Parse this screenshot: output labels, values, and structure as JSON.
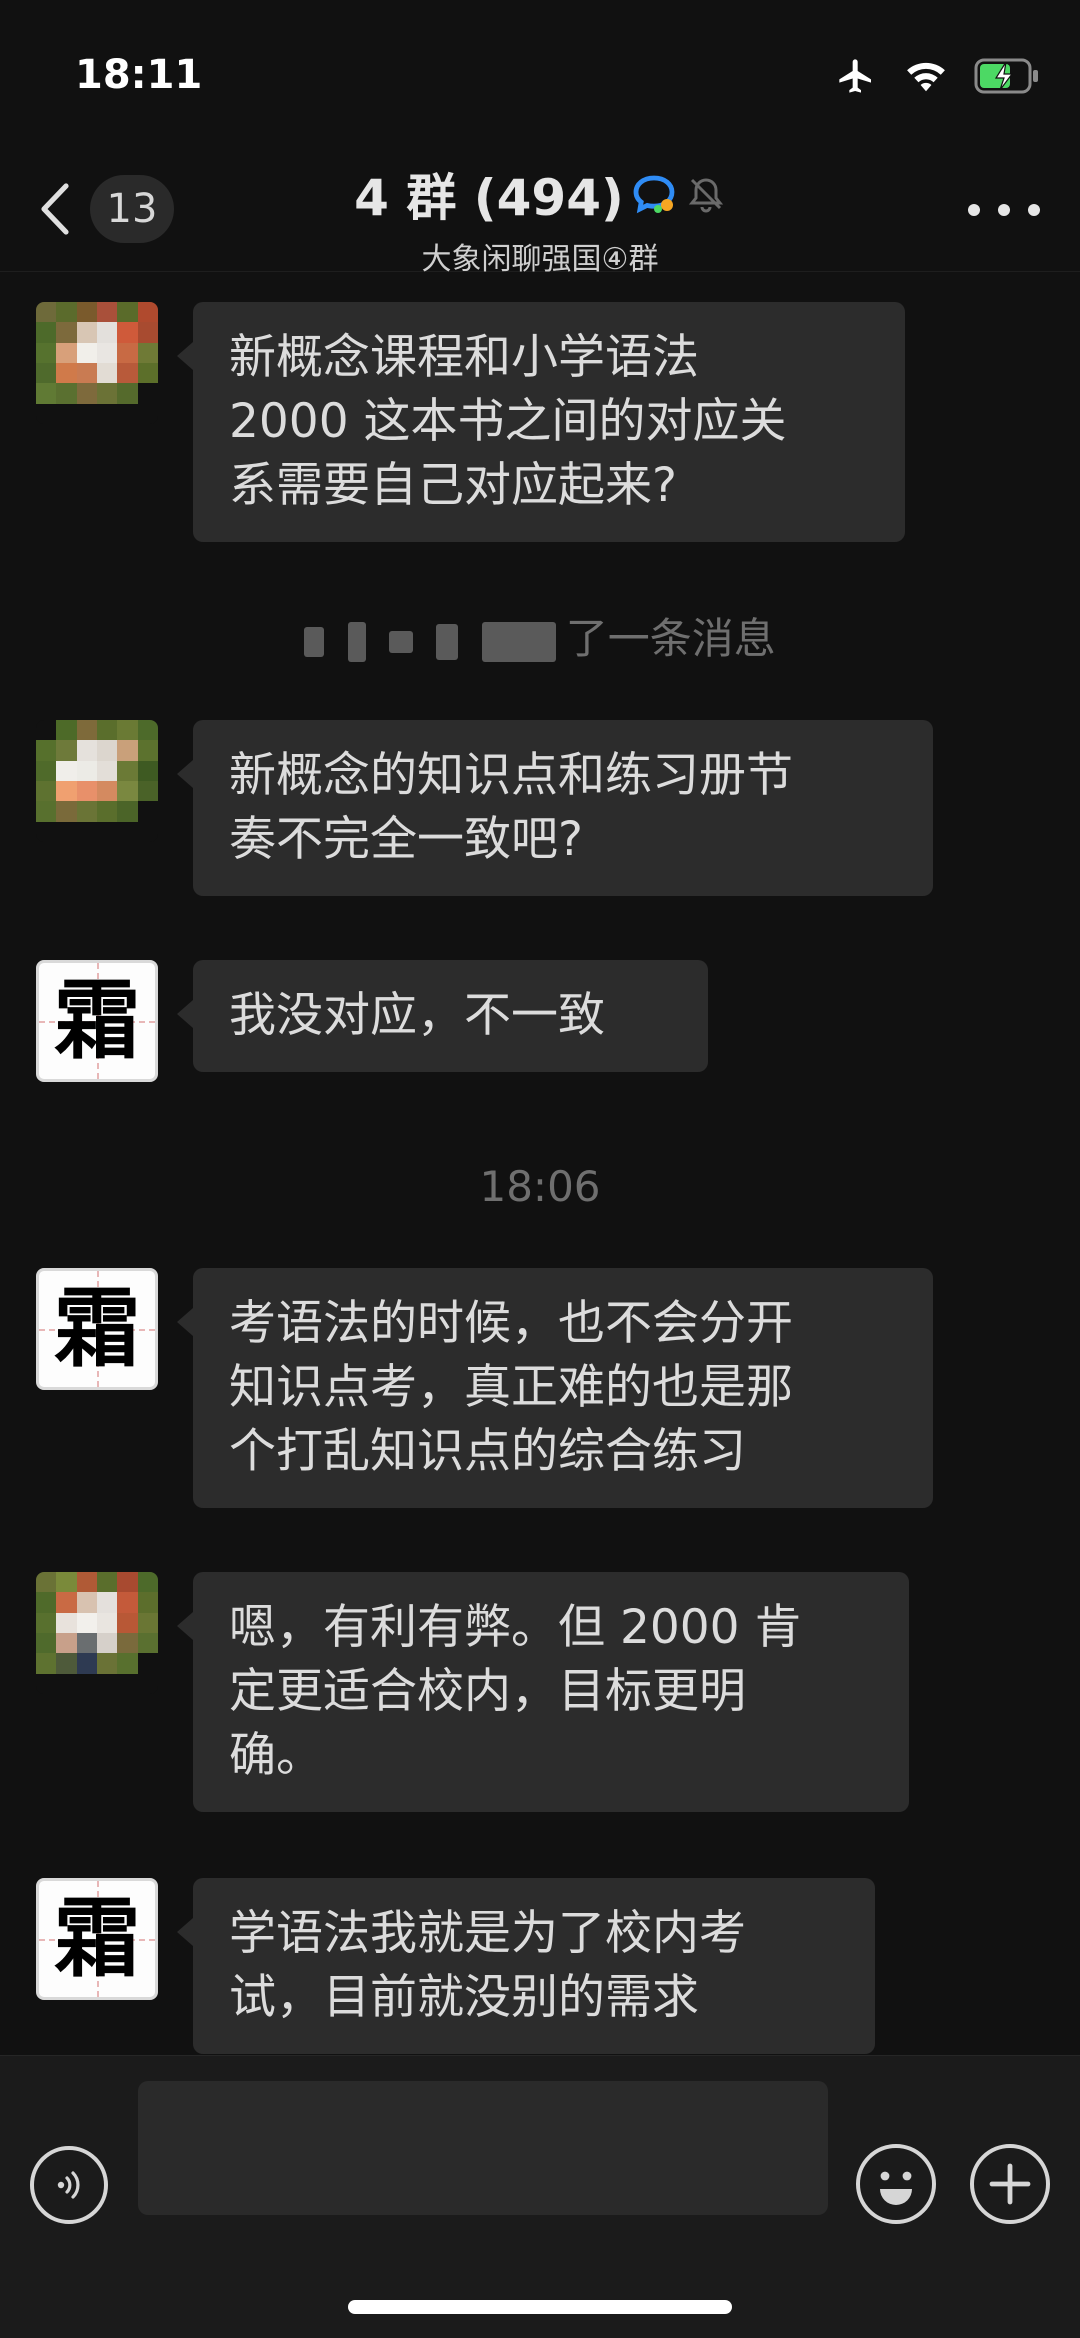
{
  "status_bar": {
    "time": "18:11",
    "icons": [
      "airplane-icon",
      "wifi-icon",
      "battery-charging-icon"
    ],
    "battery_color": "#4cd964"
  },
  "nav": {
    "back_icon": "chevron-left-icon",
    "unread_count": "13",
    "title": "4 群 (494)",
    "title_badge_icon": "group-chat-badge-icon",
    "mute_icon": "bell-off-icon",
    "subtitle": "大象闲聊强国④群",
    "more_icon": "more-dots-icon"
  },
  "messages": [
    {
      "sender_type": "pixelated",
      "text_lines": [
        "新概念课程和小学语法",
        "2000 这本书之间的对应关",
        "系需要自己对应起来?"
      ]
    },
    {
      "system": true,
      "text": "了一条消息"
    },
    {
      "sender_type": "pixelated",
      "text_lines": [
        "新概念的知识点和练习册节",
        "奏不完全一致吧?"
      ]
    },
    {
      "sender_type": "shuang",
      "avatar_char": "霜",
      "text_lines": [
        "我没对应，不一致"
      ]
    },
    {
      "timestamp": "18:06"
    },
    {
      "sender_type": "shuang",
      "avatar_char": "霜",
      "text_lines": [
        "考语法的时候，也不会分开",
        "知识点考，真正难的也是那",
        "个打乱知识点的综合练习"
      ]
    },
    {
      "sender_type": "pixelated",
      "text_lines": [
        "嗯，有利有弊。但 2000 肯",
        "定更适合校内，目标更明",
        "确。"
      ]
    },
    {
      "sender_type": "shuang",
      "avatar_char": "霜",
      "text_lines": [
        "学语法我就是为了校内考",
        "试，目前就没别的需求"
      ]
    }
  ],
  "input_bar": {
    "voice_icon": "voice-icon",
    "input_value": "",
    "emoji_icon": "emoji-icon",
    "plus_icon": "plus-icon"
  },
  "colors": {
    "background": "#111111",
    "bubble": "#2c2c2c",
    "text": "#dcdcdc",
    "system_text": "#6f6f6f"
  }
}
